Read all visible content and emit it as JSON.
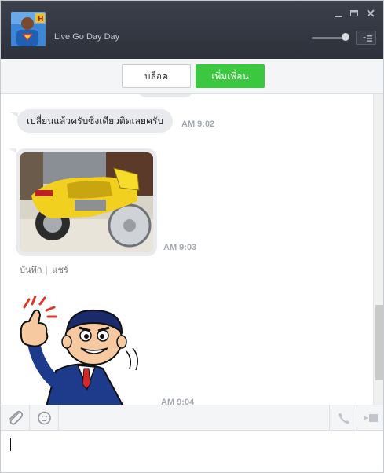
{
  "window": {
    "contact_name": "Live Go Day Day",
    "controls": {
      "minimize": "–",
      "maximize": "□",
      "close": "✕"
    },
    "volume_level": 0.8
  },
  "actions": {
    "block_label": "บล็อค",
    "add_friend_label": "เพิ่มเพื่อน"
  },
  "messages": [
    {
      "type": "text",
      "text": "เปลี่ยนแล้วครับซิ่งเดียวติดเลยครับ",
      "time": "AM 9:02"
    },
    {
      "type": "image",
      "time": "AM 9:03",
      "actions": {
        "save": "บันทึก",
        "share": "แชร์"
      }
    },
    {
      "type": "sticker",
      "time": "AM 9:04"
    }
  ],
  "icons": {
    "attach": "paperclip-icon",
    "emoji": "smiley-icon",
    "call": "phone-icon",
    "video": "video-camera-icon",
    "menu": "menu-list-icon"
  },
  "colors": {
    "titlebar": "#2d313a",
    "accent_green": "#3bc740",
    "bubble": "#e8eaed",
    "timestamp": "#a3a8b0"
  },
  "input": {
    "value": "",
    "placeholder": ""
  }
}
